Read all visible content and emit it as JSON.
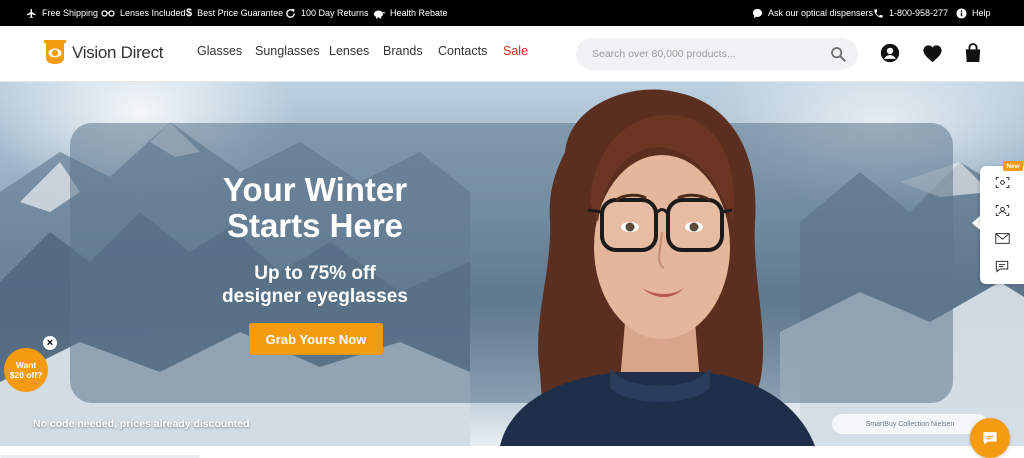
{
  "topbar": {
    "items_left": [
      {
        "icon": "airplane-icon",
        "label": "Free Shipping"
      },
      {
        "icon": "glasses-icon",
        "label": "Lenses Included"
      },
      {
        "icon": "dollar-icon",
        "label": "Best Price Guarantee"
      },
      {
        "icon": "return-arrow-icon",
        "label": "100 Day Returns"
      },
      {
        "icon": "piggy-bank-icon",
        "label": "Health Rebate"
      }
    ],
    "items_right": [
      {
        "icon": "chat-bubble-icon",
        "label": "Ask our optical dispensers"
      },
      {
        "icon": "phone-icon",
        "label": "1-800-958-277"
      },
      {
        "icon": "info-icon",
        "label": "Help"
      }
    ]
  },
  "header": {
    "logo_text": "Vision Direct",
    "nav": [
      "Glasses",
      "Sunglasses",
      "Lenses",
      "Brands",
      "Contacts",
      "Sale"
    ],
    "search_placeholder": "Search over 80,000 products...",
    "icons": [
      "account-icon",
      "heart-icon",
      "bag-icon"
    ]
  },
  "hero": {
    "title_line1": "Your Winter",
    "title_line2": "Starts Here",
    "subtitle_line1": "Up to 75% off",
    "subtitle_line2": "designer eyeglasses",
    "cta_label": "Grab Yours Now",
    "disclaimer": "No code needed, prices already discounted",
    "collection_chip": "SmartBuy Collection Nielsen"
  },
  "promo": {
    "line1": "Want",
    "line2": "$20 off?",
    "close": "×"
  },
  "side_toolbar": {
    "badge": "New",
    "buttons": [
      "face-scan-icon",
      "virtual-try-on-icon",
      "email-icon",
      "message-icon"
    ]
  },
  "colors": {
    "accent": "#f59b12",
    "sale": "#d8311d",
    "topbar": "#000000"
  }
}
